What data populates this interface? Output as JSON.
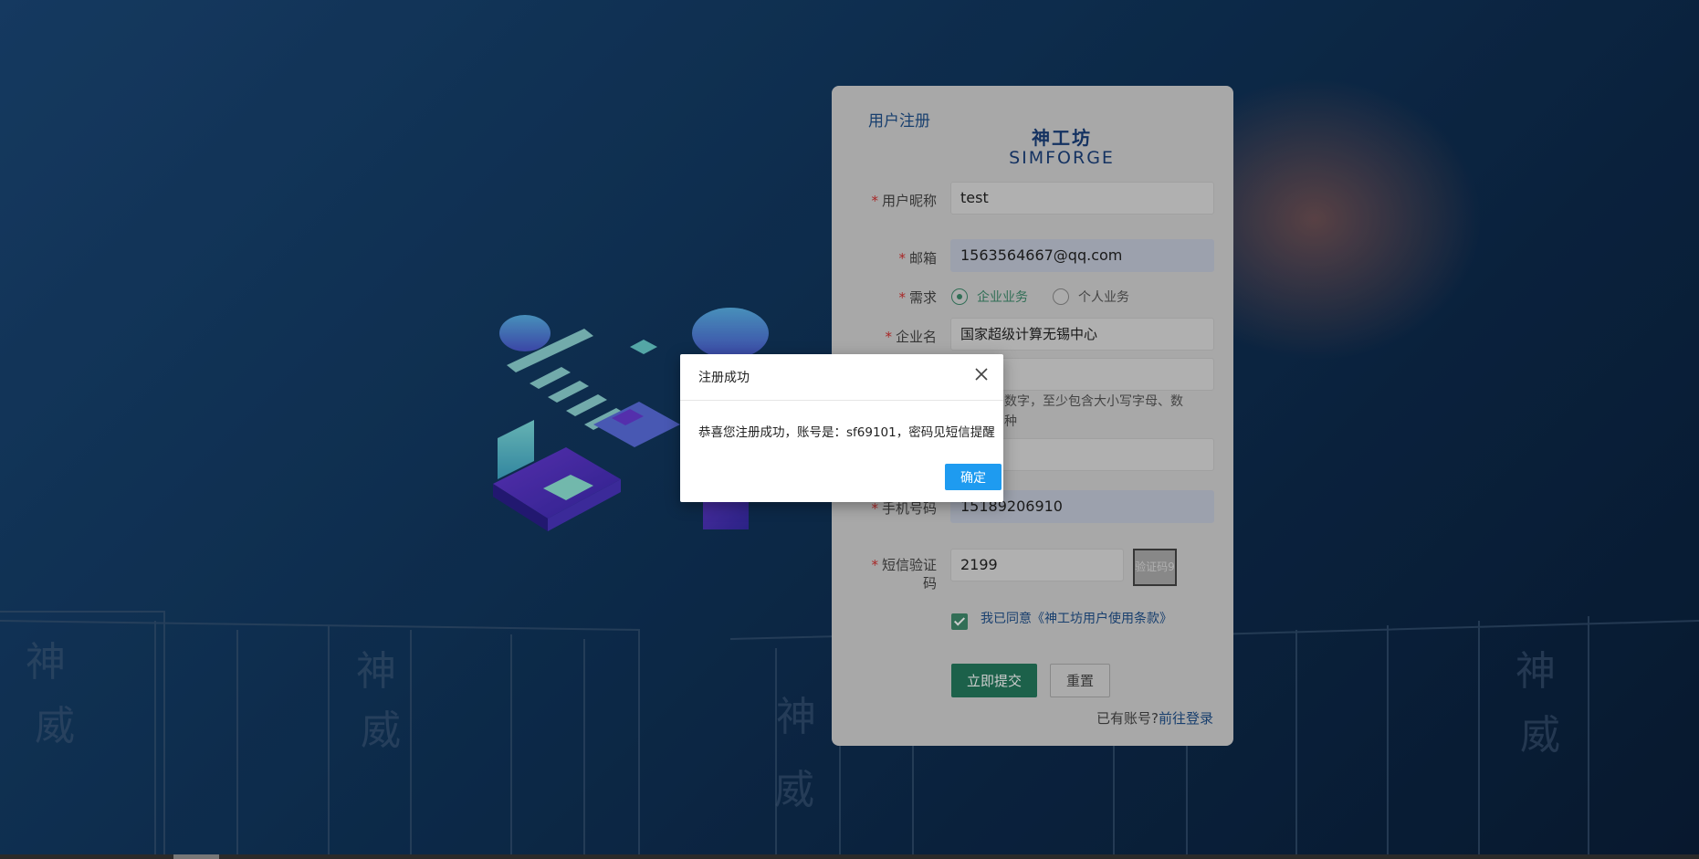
{
  "register": {
    "title": "用户注册",
    "logo_cn": "神工坊",
    "logo_en": "SIMFORGE",
    "required_mark": "*",
    "nickname": {
      "label": "用户昵称",
      "value": "test"
    },
    "email": {
      "label": "邮箱",
      "value": "1563564667@qq.com"
    },
    "demand": {
      "label": "需求",
      "option_enterprise": "企业业务",
      "option_personal": "个人业务",
      "selected": "企业业务"
    },
    "company": {
      "label": "企业名",
      "value": "国家超级计算无锡中心"
    },
    "password_hint_line1": "数字，至少包含大小写字母、数",
    "password_hint_line2": "种",
    "phone": {
      "label": "手机号码",
      "value": "15189206910"
    },
    "sms": {
      "label_line1": "短信验证",
      "label_line2": "码",
      "value": "2199",
      "button": "验证码9"
    },
    "agree_text": "我已同意《神工坊用户使用条款》",
    "agree_checked": true,
    "submit_label": "立即提交",
    "reset_label": "重置",
    "has_account": "已有账号?",
    "go_login": "前往登录"
  },
  "dialog": {
    "title": "注册成功",
    "message": "恭喜您注册成功，账号是：sf69101，密码见短信提醒",
    "ok_label": "确定"
  },
  "colors": {
    "accent_green": "#237a5d",
    "primary_blue": "#1e9bf0",
    "required_red": "#d23030"
  }
}
